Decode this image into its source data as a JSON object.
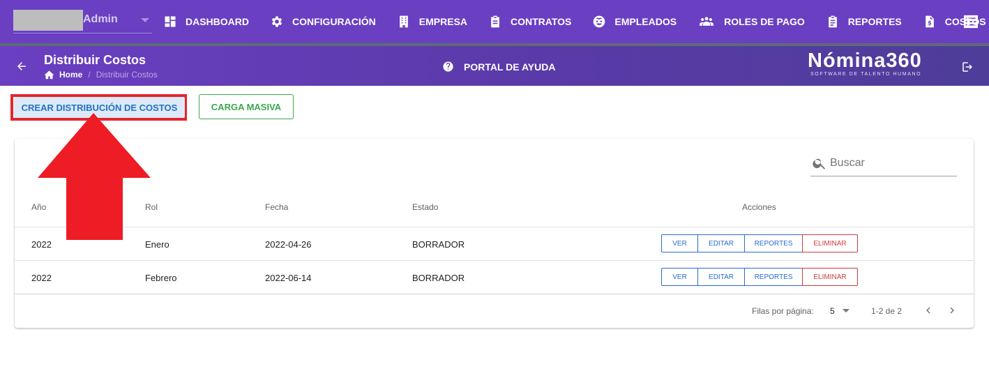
{
  "user": {
    "name": "Admin"
  },
  "nav": [
    {
      "label": "DASHBOARD",
      "icon": "dashboard-icon"
    },
    {
      "label": "CONFIGURACIÓN",
      "icon": "gear-icon"
    },
    {
      "label": "EMPRESA",
      "icon": "building-icon"
    },
    {
      "label": "CONTRATOS",
      "icon": "clipboard-icon"
    },
    {
      "label": "EMPLEADOS",
      "icon": "face-icon"
    },
    {
      "label": "ROLES DE PAGO",
      "icon": "people-icon"
    },
    {
      "label": "REPORTES",
      "icon": "clipboard-list-icon"
    },
    {
      "label": "COSTOS",
      "icon": "dollar-file-icon"
    }
  ],
  "header": {
    "title": "Distribuir Costos",
    "breadcrumb": {
      "home": "Home",
      "separator": "/",
      "current": "Distribuir Costos"
    },
    "help": "PORTAL DE AYUDA",
    "logo": {
      "main": "Nómina360",
      "sub": "SOFTWARE DE TALENTO HUMANO"
    }
  },
  "toolbar": {
    "create_label": "CREAR DISTRIBUCIÓN DE COSTOS",
    "bulk_label": "CARGA MASIVA"
  },
  "search": {
    "placeholder": "Buscar"
  },
  "table": {
    "columns": [
      "Año",
      "Rol",
      "Fecha",
      "Estado",
      "Acciones"
    ],
    "rows": [
      {
        "year": "2022",
        "role": "Enero",
        "date": "2022-04-26",
        "status": "BORRADOR"
      },
      {
        "year": "2022",
        "role": "Febrero",
        "date": "2022-06-14",
        "status": "BORRADOR"
      }
    ],
    "actions": {
      "view": "VER",
      "edit": "EDITAR",
      "reports": "REPORTES",
      "delete": "ELIMINAR"
    }
  },
  "pagination": {
    "rows_per_page_label": "Filas por página:",
    "rows_per_page": "5",
    "range": "1-2 de 2"
  },
  "colors": {
    "brand": "#6a3fc2",
    "highlight": "#e3262d",
    "primary": "#2a6bd0",
    "success": "#3aa84b",
    "danger": "#d23a3a"
  }
}
